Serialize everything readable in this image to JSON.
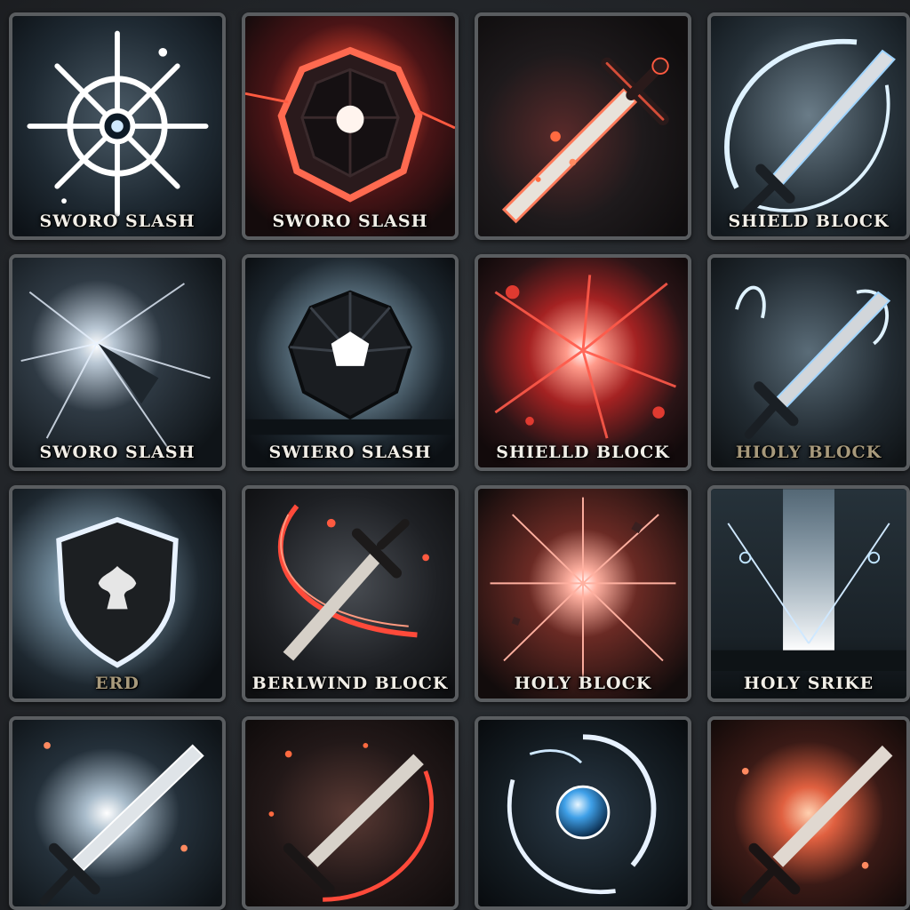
{
  "grid": {
    "rows": [
      [
        {
          "label": "SWORO SLASH",
          "icon": "radiant-star-icon",
          "theme": "white"
        },
        {
          "label": "SWORO SLASH",
          "icon": "shield-burst-icon",
          "theme": "red"
        },
        {
          "label": "",
          "icon": "flaming-sword-icon",
          "theme": "red"
        },
        {
          "label": "SHIELD BLOCK",
          "icon": "sword-swirl-icon",
          "theme": "blue"
        }
      ],
      [
        {
          "label": "SWORO SLASH",
          "icon": "slash-burst-icon",
          "theme": "white"
        },
        {
          "label": "SWIERO SLASH",
          "icon": "gem-shield-icon",
          "theme": "blue"
        },
        {
          "label": "SHIELLD BLOCK",
          "icon": "red-explosion-icon",
          "theme": "red"
        },
        {
          "label": "HIOLY BLOCK",
          "icon": "sword-splash-icon",
          "theme": "blue"
        }
      ],
      [
        {
          "label": "ERD",
          "icon": "heraldic-shield-icon",
          "theme": "blue"
        },
        {
          "label": "BERLWIND BLOCK",
          "icon": "sword-red-arc-icon",
          "theme": "red"
        },
        {
          "label": "HOLY BLOCK",
          "icon": "starburst-icon",
          "theme": "red"
        },
        {
          "label": "HOLY SRIKE",
          "icon": "light-pillar-icon",
          "theme": "blue"
        }
      ],
      [
        {
          "label": "",
          "icon": "glowing-sword-icon",
          "theme": "white"
        },
        {
          "label": "",
          "icon": "ember-sword-icon",
          "theme": "red"
        },
        {
          "label": "",
          "icon": "vortex-orb-icon",
          "theme": "blue"
        },
        {
          "label": "",
          "icon": "fire-sword-icon",
          "theme": "red"
        }
      ]
    ]
  },
  "colors": {
    "frame": "#5a5d60",
    "background": "#26292d",
    "red_glow": "#ff4a3a",
    "blue_glow": "#bfe4ff",
    "white_glow": "#ffffff"
  }
}
